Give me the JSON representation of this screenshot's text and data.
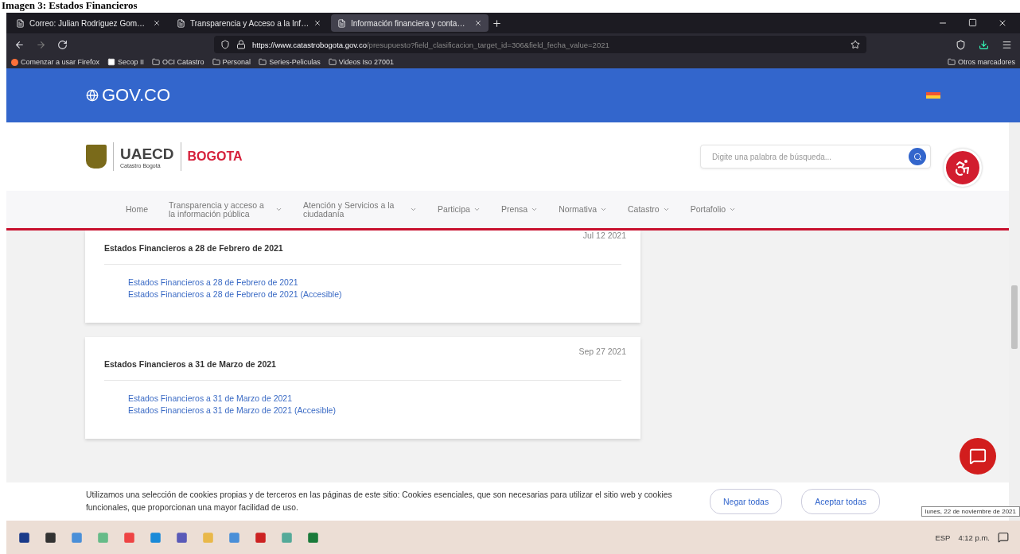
{
  "caption": "Imagen 3: Estados Financieros",
  "browser": {
    "tabs": [
      {
        "title": "Correo: Julian Rodriguez Gom…",
        "selected": false
      },
      {
        "title": "Transparencia y Acceso a la Inf…",
        "selected": false
      },
      {
        "title": "Información financiera y conta…",
        "selected": true
      }
    ],
    "url_host": "https://www.catastrobogota.gov.co",
    "url_path": "/presupuesto?field_clasificacion_target_id=306&field_fecha_value=2021",
    "bookmarks": [
      {
        "label": "Comenzar a usar Firefox",
        "kind": "firefox"
      },
      {
        "label": "Secop II",
        "kind": "page"
      },
      {
        "label": "OCI Catastro",
        "kind": "folder"
      },
      {
        "label": "Personal",
        "kind": "folder"
      },
      {
        "label": "Series-Peliculas",
        "kind": "folder"
      },
      {
        "label": "Videos Iso 27001",
        "kind": "folder"
      }
    ],
    "other_bookmarks": "Otros marcadores"
  },
  "gov_bar": {
    "logo": "GOV.CO"
  },
  "header": {
    "uaecd": "UAECD",
    "uaecd_sub": "Catastro Bogotá",
    "bogota": "BOGOTA",
    "search_placeholder": "Digite una palabra de búsqueda..."
  },
  "menu": [
    {
      "label": "Home",
      "dropdown": false
    },
    {
      "label": "Transparencia y acceso a la información pública",
      "dropdown": true
    },
    {
      "label": "Atención y Servicios a la ciudadanía",
      "dropdown": true
    },
    {
      "label": "Participa",
      "dropdown": true
    },
    {
      "label": "Prensa",
      "dropdown": true
    },
    {
      "label": "Normativa",
      "dropdown": true
    },
    {
      "label": "Catastro",
      "dropdown": true
    },
    {
      "label": "Portafolio",
      "dropdown": true
    }
  ],
  "cards": [
    {
      "date": "Jul 12 2021",
      "title": "Estados Financieros a 28 de Febrero de 2021",
      "links": [
        "Estados Financieros a 28 de Febrero de 2021",
        "Estados Financieros a 28 de Febrero de 2021 (Accesible)"
      ]
    },
    {
      "date": "Sep 27 2021",
      "title": "Estados Financieros a 31 de Marzo de 2021",
      "links": [
        "Estados Financieros a 31 de Marzo de 2021",
        "Estados Financieros a 31 de Marzo de 2021 (Accesible)"
      ]
    }
  ],
  "cookies": {
    "text": "Utilizamos una selección de cookies propias y de terceros en las páginas de este sitio: Cookies esenciales, que son necesarias para utilizar el sitio web y cookies funcionales, que proporcionan una mayor facilidad de uso.",
    "buttons": [
      "Negar todas",
      "Aceptar todas"
    ]
  },
  "taskbar": {
    "language": "ESP",
    "time": "4:12 p.m.",
    "tooltip": "lunes, 22 de noviembre de 2021"
  }
}
